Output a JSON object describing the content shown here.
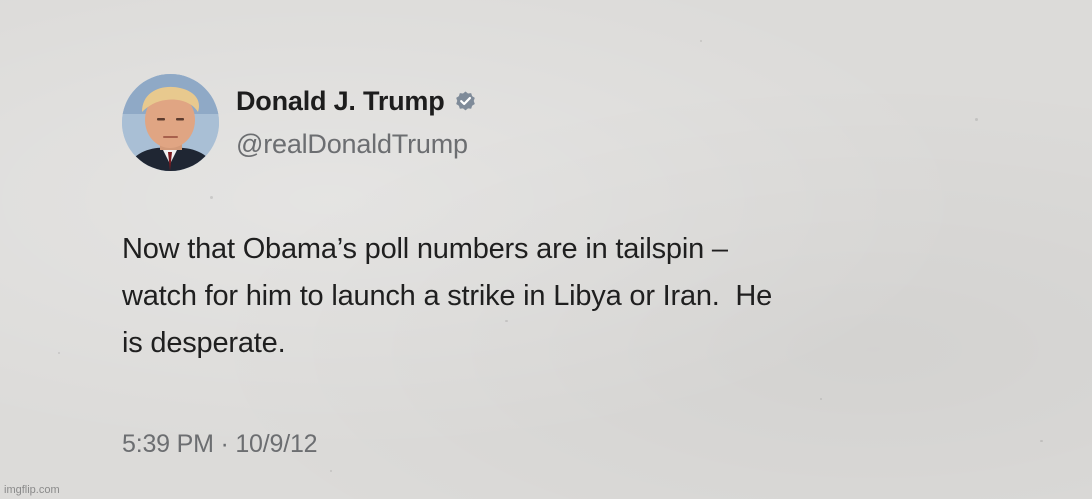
{
  "tweet": {
    "author": {
      "display_name": "Donald J. Trump",
      "handle": "@realDonaldTrump",
      "verified_icon": "verified-badge-icon",
      "avatar": "profile-photo"
    },
    "text": "Now that Obama’s poll numbers are in tailspin –\nwatch for him to launch a strike in Libya or Iran.  He\nis desperate.",
    "time": "5:39 PM",
    "separator": "·",
    "date": "10/9/12"
  },
  "watermark": "imgflip.com",
  "colors": {
    "background": "#dcdbd9",
    "name_text": "#1d1d1d",
    "secondary_text": "#6c6e71",
    "verified_badge": "#7f8b99"
  }
}
